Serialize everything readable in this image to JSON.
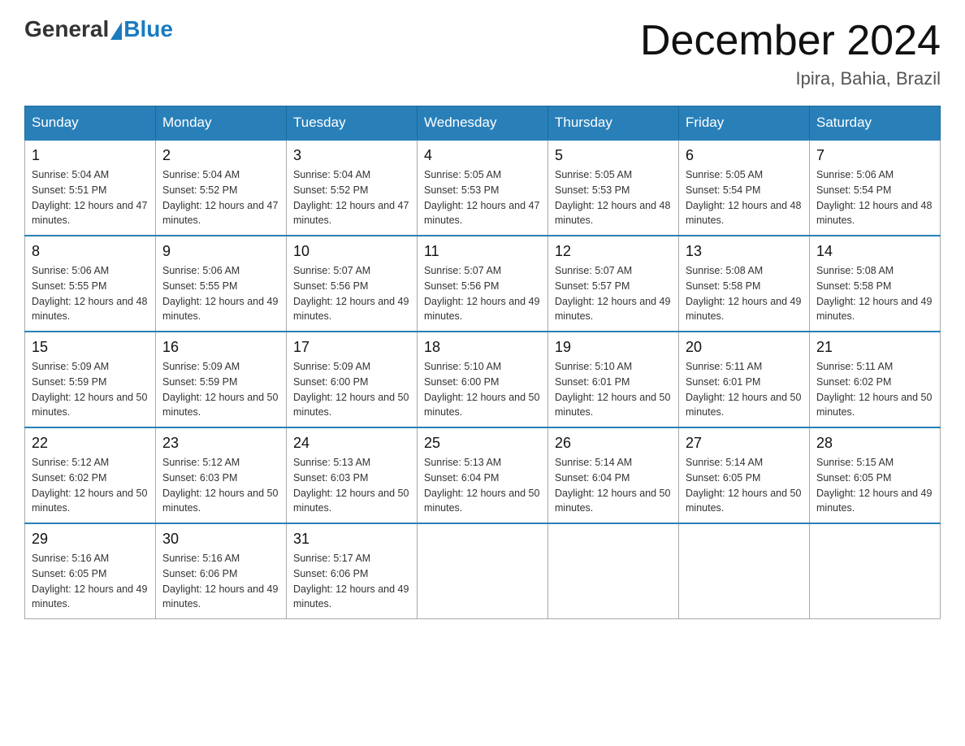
{
  "logo": {
    "general": "General",
    "blue": "Blue"
  },
  "title": {
    "month_year": "December 2024",
    "location": "Ipira, Bahia, Brazil"
  },
  "weekdays": [
    "Sunday",
    "Monday",
    "Tuesday",
    "Wednesday",
    "Thursday",
    "Friday",
    "Saturday"
  ],
  "weeks": [
    [
      {
        "day": "1",
        "sunrise": "5:04 AM",
        "sunset": "5:51 PM",
        "daylight": "12 hours and 47 minutes."
      },
      {
        "day": "2",
        "sunrise": "5:04 AM",
        "sunset": "5:52 PM",
        "daylight": "12 hours and 47 minutes."
      },
      {
        "day": "3",
        "sunrise": "5:04 AM",
        "sunset": "5:52 PM",
        "daylight": "12 hours and 47 minutes."
      },
      {
        "day": "4",
        "sunrise": "5:05 AM",
        "sunset": "5:53 PM",
        "daylight": "12 hours and 47 minutes."
      },
      {
        "day": "5",
        "sunrise": "5:05 AM",
        "sunset": "5:53 PM",
        "daylight": "12 hours and 48 minutes."
      },
      {
        "day": "6",
        "sunrise": "5:05 AM",
        "sunset": "5:54 PM",
        "daylight": "12 hours and 48 minutes."
      },
      {
        "day": "7",
        "sunrise": "5:06 AM",
        "sunset": "5:54 PM",
        "daylight": "12 hours and 48 minutes."
      }
    ],
    [
      {
        "day": "8",
        "sunrise": "5:06 AM",
        "sunset": "5:55 PM",
        "daylight": "12 hours and 48 minutes."
      },
      {
        "day": "9",
        "sunrise": "5:06 AM",
        "sunset": "5:55 PM",
        "daylight": "12 hours and 49 minutes."
      },
      {
        "day": "10",
        "sunrise": "5:07 AM",
        "sunset": "5:56 PM",
        "daylight": "12 hours and 49 minutes."
      },
      {
        "day": "11",
        "sunrise": "5:07 AM",
        "sunset": "5:56 PM",
        "daylight": "12 hours and 49 minutes."
      },
      {
        "day": "12",
        "sunrise": "5:07 AM",
        "sunset": "5:57 PM",
        "daylight": "12 hours and 49 minutes."
      },
      {
        "day": "13",
        "sunrise": "5:08 AM",
        "sunset": "5:58 PM",
        "daylight": "12 hours and 49 minutes."
      },
      {
        "day": "14",
        "sunrise": "5:08 AM",
        "sunset": "5:58 PM",
        "daylight": "12 hours and 49 minutes."
      }
    ],
    [
      {
        "day": "15",
        "sunrise": "5:09 AM",
        "sunset": "5:59 PM",
        "daylight": "12 hours and 50 minutes."
      },
      {
        "day": "16",
        "sunrise": "5:09 AM",
        "sunset": "5:59 PM",
        "daylight": "12 hours and 50 minutes."
      },
      {
        "day": "17",
        "sunrise": "5:09 AM",
        "sunset": "6:00 PM",
        "daylight": "12 hours and 50 minutes."
      },
      {
        "day": "18",
        "sunrise": "5:10 AM",
        "sunset": "6:00 PM",
        "daylight": "12 hours and 50 minutes."
      },
      {
        "day": "19",
        "sunrise": "5:10 AM",
        "sunset": "6:01 PM",
        "daylight": "12 hours and 50 minutes."
      },
      {
        "day": "20",
        "sunrise": "5:11 AM",
        "sunset": "6:01 PM",
        "daylight": "12 hours and 50 minutes."
      },
      {
        "day": "21",
        "sunrise": "5:11 AM",
        "sunset": "6:02 PM",
        "daylight": "12 hours and 50 minutes."
      }
    ],
    [
      {
        "day": "22",
        "sunrise": "5:12 AM",
        "sunset": "6:02 PM",
        "daylight": "12 hours and 50 minutes."
      },
      {
        "day": "23",
        "sunrise": "5:12 AM",
        "sunset": "6:03 PM",
        "daylight": "12 hours and 50 minutes."
      },
      {
        "day": "24",
        "sunrise": "5:13 AM",
        "sunset": "6:03 PM",
        "daylight": "12 hours and 50 minutes."
      },
      {
        "day": "25",
        "sunrise": "5:13 AM",
        "sunset": "6:04 PM",
        "daylight": "12 hours and 50 minutes."
      },
      {
        "day": "26",
        "sunrise": "5:14 AM",
        "sunset": "6:04 PM",
        "daylight": "12 hours and 50 minutes."
      },
      {
        "day": "27",
        "sunrise": "5:14 AM",
        "sunset": "6:05 PM",
        "daylight": "12 hours and 50 minutes."
      },
      {
        "day": "28",
        "sunrise": "5:15 AM",
        "sunset": "6:05 PM",
        "daylight": "12 hours and 49 minutes."
      }
    ],
    [
      {
        "day": "29",
        "sunrise": "5:16 AM",
        "sunset": "6:05 PM",
        "daylight": "12 hours and 49 minutes."
      },
      {
        "day": "30",
        "sunrise": "5:16 AM",
        "sunset": "6:06 PM",
        "daylight": "12 hours and 49 minutes."
      },
      {
        "day": "31",
        "sunrise": "5:17 AM",
        "sunset": "6:06 PM",
        "daylight": "12 hours and 49 minutes."
      },
      null,
      null,
      null,
      null
    ]
  ]
}
